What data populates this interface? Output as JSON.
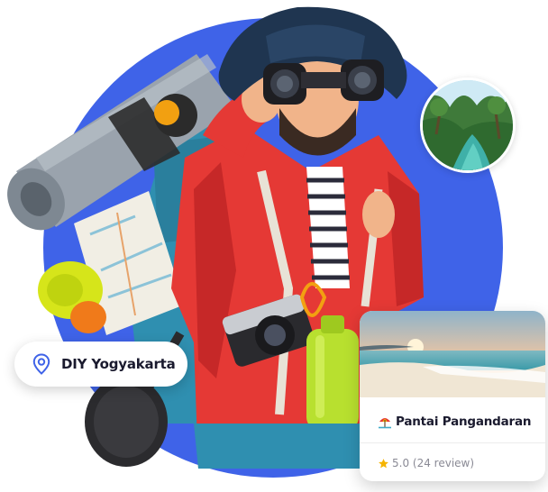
{
  "location": {
    "label": "DIY Yogyakarta",
    "icon": "map-pin-icon"
  },
  "place_card": {
    "title": "Pantai Pangandaran",
    "title_icon": "beach-umbrella-icon",
    "rating_icon": "star-icon",
    "rating": "5.0 (24 review)"
  },
  "colors": {
    "brand_blue": "#3f63e8",
    "jacket_red": "#e53935",
    "hat_navy": "#1f3550",
    "pin_icon": "#3f63e8",
    "star": "#f5b400"
  }
}
